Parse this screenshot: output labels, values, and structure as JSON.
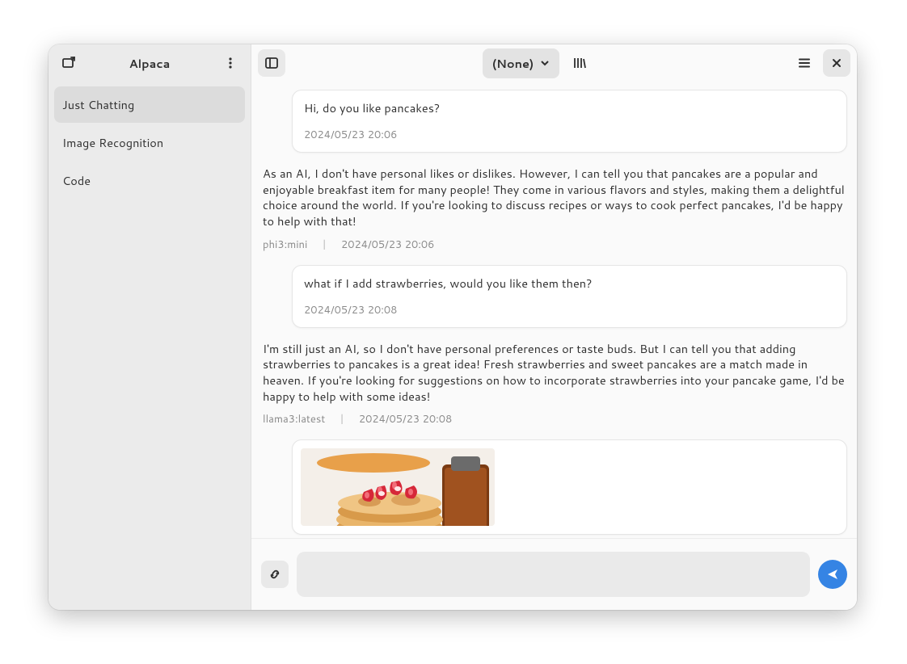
{
  "sidebar": {
    "title": "Alpaca",
    "items": [
      {
        "label": "Just Chatting",
        "active": true
      },
      {
        "label": "Image Recognition",
        "active": false
      },
      {
        "label": "Code",
        "active": false
      }
    ]
  },
  "header": {
    "model_label": "(None)"
  },
  "conversation": {
    "title": "Just Chatting",
    "messages": [
      {
        "role": "user",
        "text": "Hi, do you like pancakes?",
        "timestamp": "2024/05/23 20:06"
      },
      {
        "role": "ai",
        "model": "phi3:mini",
        "text": "As an AI, I don't have personal likes or dislikes. However, I can tell you that pancakes are a popular and enjoyable breakfast item for many people! They come in various flavors and styles, making them a delightful choice around the world. If you're looking to discuss recipes or ways to cook perfect pancakes, I'd be happy to help with that!",
        "timestamp": "2024/05/23 20:06"
      },
      {
        "role": "user",
        "text": "what if I add strawberries, would you like them then?",
        "timestamp": "2024/05/23 20:08"
      },
      {
        "role": "ai",
        "model": "llama3:latest",
        "text": "I'm still just an AI, so I don't have personal preferences or taste buds. But I can tell you that adding strawberries to pancakes is a great idea! Fresh strawberries and sweet pancakes are a match made in heaven. If you're looking for suggestions on how to incorporate strawberries into your pancake game, I'd be happy to help with some ideas!",
        "timestamp": "2024/05/23 20:08"
      },
      {
        "role": "user_image",
        "alt": "Stack of pancakes topped with sliced strawberries, jar of syrup in background"
      }
    ]
  },
  "composer": {
    "placeholder": "",
    "value": ""
  },
  "meta_sep": "|"
}
